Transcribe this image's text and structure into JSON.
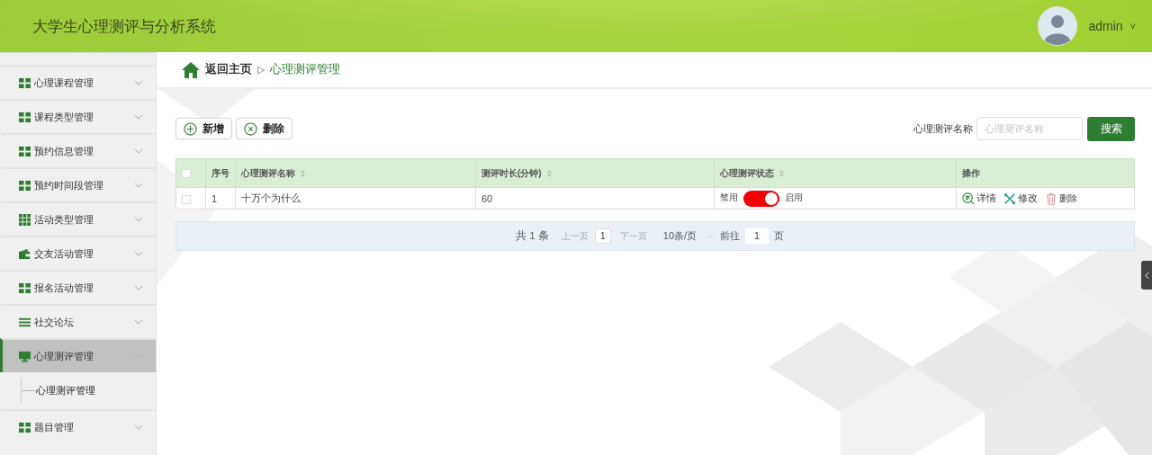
{
  "header": {
    "title": "大学生心理测评与分析系统",
    "user": {
      "name": "admin",
      "caret": "˅"
    }
  },
  "sidebar": {
    "items": [
      {
        "label": "心理课程管理",
        "expanded": false
      },
      {
        "label": "课程类型管理",
        "expanded": false
      },
      {
        "label": "预约信息管理",
        "expanded": false
      },
      {
        "label": "预约时间段管理",
        "expanded": false
      },
      {
        "label": "活动类型管理",
        "expanded": false
      },
      {
        "label": "交友活动管理",
        "expanded": false
      },
      {
        "label": "报名活动管理",
        "expanded": false
      },
      {
        "label": "社交论坛",
        "expanded": false
      },
      {
        "label": "心理测评管理",
        "expanded": true,
        "children": [
          {
            "label": "心理测评管理"
          }
        ]
      },
      {
        "label": "题目管理",
        "expanded": false
      }
    ]
  },
  "breadcrumb": {
    "home": "返回主页",
    "separator": "▷",
    "current": "心理测评管理"
  },
  "toolbar": {
    "buttons": [
      {
        "kind": "add",
        "label": "新增"
      },
      {
        "kind": "delete",
        "label": "删除"
      }
    ],
    "search": {
      "label": "心理测评名称",
      "placeholder": "心理测评名称",
      "button": "搜索"
    }
  },
  "table": {
    "select_all": {
      "checked": false
    },
    "columns": [
      {
        "label": "序号",
        "sortable": false
      },
      {
        "label": "心理测评名称",
        "sortable": true
      },
      {
        "label": "测评时长(分钟)",
        "sortable": true
      },
      {
        "label": "心理测评状态",
        "sortable": true
      },
      {
        "label": "操作",
        "sortable": false
      }
    ],
    "rows": [
      {
        "checked": false,
        "index": "1",
        "name": "十万个为什么",
        "duration": "60",
        "status": {
          "off_label": "禁用",
          "on_label": "启用",
          "on": true
        },
        "actions": [
          {
            "kind": "detail",
            "label": "详情"
          },
          {
            "kind": "edit",
            "label": "修改"
          },
          {
            "kind": "delete",
            "label": "删除"
          }
        ]
      }
    ]
  },
  "pagination": {
    "total": "共 1 条",
    "prev": "上一页",
    "page": "1",
    "next": "下一页",
    "page_size": "10条/页",
    "goto_label": "前往",
    "goto_value": "1",
    "goto_suffix": "页"
  }
}
